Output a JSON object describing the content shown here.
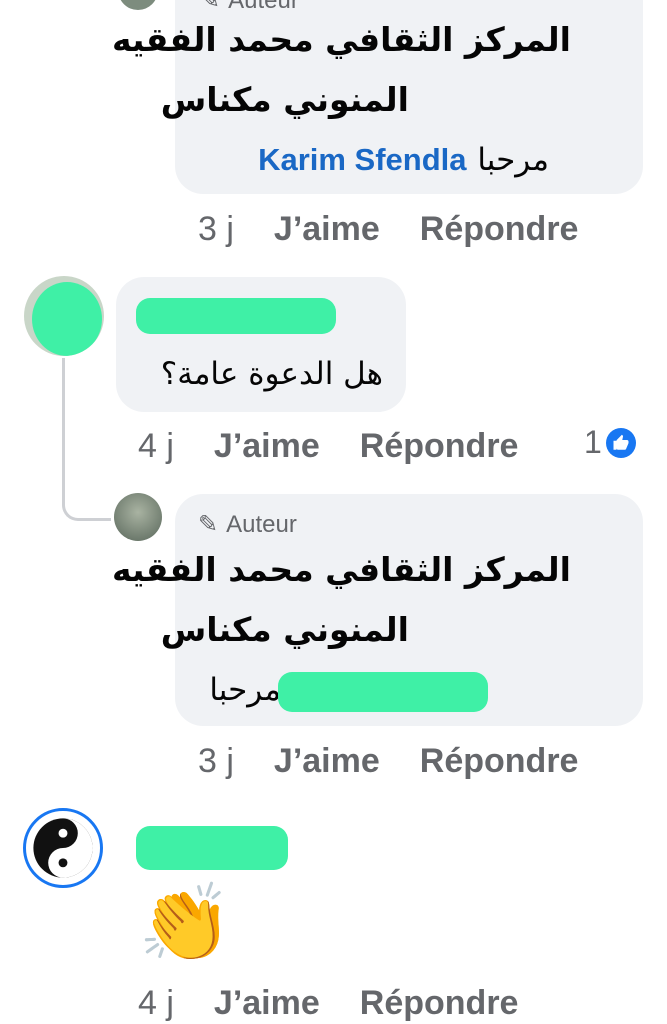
{
  "comments": [
    {
      "author_badge": "Auteur",
      "line1": "المركز الثقافي محمد الفقيه",
      "line2": "المنوني مكناس",
      "reply_prefix": "مرحبا",
      "mention": "Karim Sfendla",
      "time": "3 j",
      "like_label": "J’aime",
      "reply_label": "Répondre"
    },
    {
      "question": "هل الدعوة عامة؟",
      "time": "4 j",
      "like_label": "J’aime",
      "reply_label": "Répondre",
      "reaction_count": "1"
    },
    {
      "author_badge": "Auteur",
      "line1": "المركز الثقافي محمد الفقيه",
      "line2": "المنوني مكناس",
      "reply_prefix": "مرحبا",
      "time": "3 j",
      "like_label": "J’aime",
      "reply_label": "Répondre"
    },
    {
      "emoji": "👏",
      "time": "4 j",
      "like_label": "J’aime",
      "reply_label": "Répondre"
    }
  ],
  "icons": {
    "like": "like-thumb-icon",
    "pencil": "pencil-icon",
    "avatar_yin_yang": "yin-yang-avatar"
  },
  "colors": {
    "like_blue": "#1877f2",
    "mention_blue": "#1a68c5",
    "bubble_bg": "#f0f2f5",
    "meta_gray": "#65676b"
  }
}
